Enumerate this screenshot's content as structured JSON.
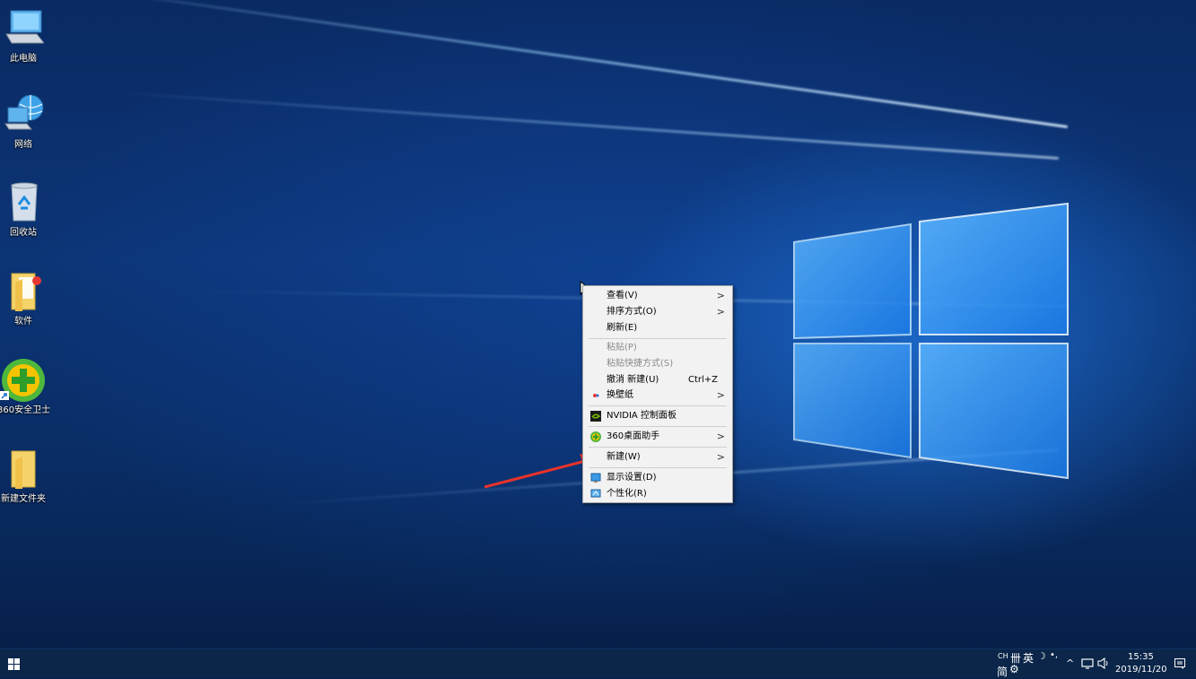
{
  "desktop": {
    "icons": [
      {
        "label": "此电脑",
        "icon": "computer-icon"
      },
      {
        "label": "网络",
        "icon": "network-icon"
      },
      {
        "label": "回收站",
        "icon": "recycle-bin-icon"
      },
      {
        "label": "软件",
        "icon": "folder-icon"
      },
      {
        "label": "360安全卫士",
        "icon": "360-security-icon"
      },
      {
        "label": "新建文件夹",
        "icon": "folder-icon"
      }
    ]
  },
  "context_menu": {
    "items": [
      {
        "label": "查看(V)",
        "submenu": true
      },
      {
        "label": "排序方式(O)",
        "submenu": true
      },
      {
        "label": "刷新(E)"
      },
      {
        "label": "粘贴(P)",
        "disabled": true
      },
      {
        "label": "粘贴快捷方式(S)",
        "disabled": true
      },
      {
        "label": "撤消 新建(U)",
        "shortcut": "Ctrl+Z"
      },
      {
        "label": "换壁纸",
        "submenu": true,
        "icon": "wallpaper-icon"
      },
      {
        "label": "NVIDIA 控制面板",
        "icon": "nvidia-icon"
      },
      {
        "label": "360桌面助手",
        "submenu": true,
        "icon": "360-icon"
      },
      {
        "label": "新建(W)",
        "submenu": true
      },
      {
        "label": "显示设置(D)",
        "icon": "display-icon"
      },
      {
        "label": "个性化(R)",
        "icon": "personalize-icon"
      }
    ],
    "arrow_glyph": ">"
  },
  "annotation": {
    "color": "#e8332a"
  },
  "taskbar": {
    "ime_top": "CH",
    "ime_grid": "卌",
    "ime_lang": "英",
    "ime_moon": "☽",
    "ime_dot": "•,",
    "ime_bottom": "简",
    "ime_gear": "⚙",
    "chevron": "^",
    "time": "15:35",
    "date": "2019/11/20",
    "accent": "#0b2649"
  }
}
